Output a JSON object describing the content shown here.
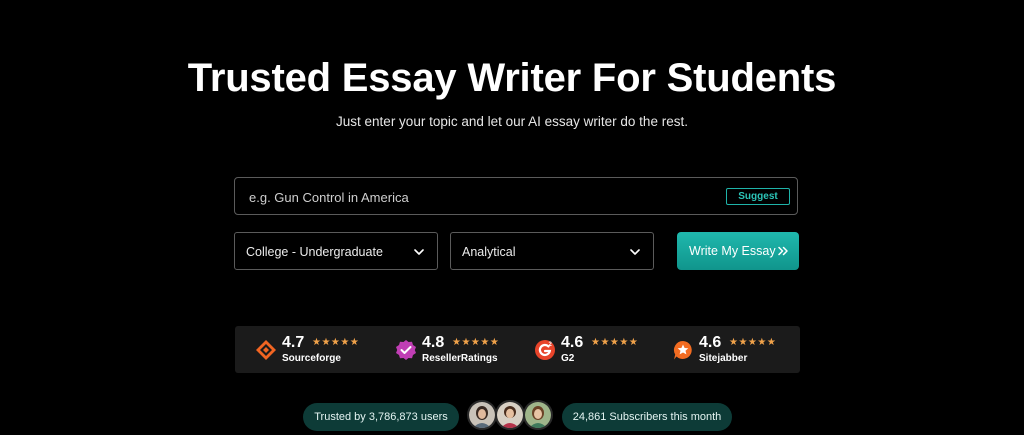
{
  "hero": {
    "title": "Trusted Essay Writer For Students",
    "subtitle": "Just enter your topic and let our AI essay writer do the rest."
  },
  "form": {
    "topic_placeholder": "e.g. Gun Control in America",
    "topic_value": "",
    "suggest_label": "Suggest",
    "level_selected": "College - Undergraduate",
    "type_selected": "Analytical",
    "submit_label": "Write My Essay"
  },
  "ratings": [
    {
      "score": "4.7",
      "stars": "★★★★★",
      "name": "Sourceforge",
      "icon": "sourceforge-icon"
    },
    {
      "score": "4.8",
      "stars": "★★★★★",
      "name": "ResellerRatings",
      "icon": "resellerratings-icon"
    },
    {
      "score": "4.6",
      "stars": "★★★★★",
      "name": "G2",
      "icon": "g2-icon"
    },
    {
      "score": "4.6",
      "stars": "★★★★★",
      "name": "Sitejabber",
      "icon": "sitejabber-icon"
    }
  ],
  "social_proof": {
    "trusted_text": "Trusted by 3,786,873 users",
    "subscribers_text": "24,861 Subscribers this month"
  },
  "colors": {
    "accent": "#1fb3a9",
    "star": "#f0a24a",
    "pill_bg": "#0d3b37"
  }
}
